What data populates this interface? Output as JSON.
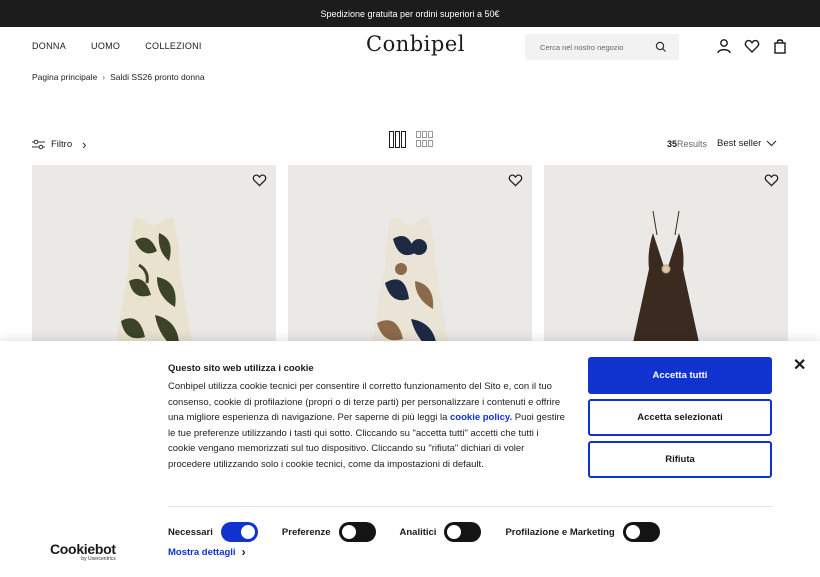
{
  "topbar": {
    "promo": "Spedizione gratuita per ordini superiori a 50€"
  },
  "header": {
    "nav": [
      "DONNA",
      "UOMO",
      "COLLEZIONI"
    ],
    "logo": "Conbipel",
    "search_placeholder": "Cerca nel nostro negozio",
    "icons": [
      "account-icon",
      "wishlist-icon",
      "bag-icon"
    ]
  },
  "breadcrumb": {
    "home": "Pagina principale",
    "current": "Saldi SS26 pronto donna"
  },
  "listing": {
    "filter_label": "Filtro",
    "results_count": "35",
    "results_label": "Results",
    "sort_label": "Best seller"
  },
  "products": [
    {
      "name": "dress-1",
      "pattern": "leaf-olive"
    },
    {
      "name": "dress-2",
      "pattern": "floral-navy"
    },
    {
      "name": "dress-3",
      "pattern": "solid-brown"
    }
  ],
  "cookie": {
    "title": "Questo sito web utilizza i cookie",
    "text_before": "Conbipel utilizza cookie tecnici per consentire il corretto funzionamento del Sito e, con il tuo consenso, cookie di profilazione (propri o di terze parti) per personalizzare i contenuti e offrire una migliore esperienza di navigazione. Per saperne di più leggi la",
    "link": "cookie policy.",
    "text_after": "Puoi gestire le tue preferenze utilizzando i tasti qui sotto. Cliccando su \"accetta tutti\" accetti che tutti i cookie vengano memorizzati sul tuo dispositivo. Cliccando su \"rifiuta\" dichiari di voler procedere utilizzando solo i cookie tecnici, come da impostazioni di default.",
    "accept_all": "Accetta tutti",
    "accept_selected": "Accetta selezionati",
    "reject": "Rifiuta",
    "toggles": [
      {
        "label": "Necessari",
        "on": true
      },
      {
        "label": "Preferenze",
        "on": false
      },
      {
        "label": "Analitici",
        "on": false
      },
      {
        "label": "Profilazione e Marketing",
        "on": false
      }
    ],
    "more": "Mostra dettagli",
    "brand": "Cookiebot",
    "brand_sub": "by Usercentrics",
    "accent": "#1032cf"
  }
}
